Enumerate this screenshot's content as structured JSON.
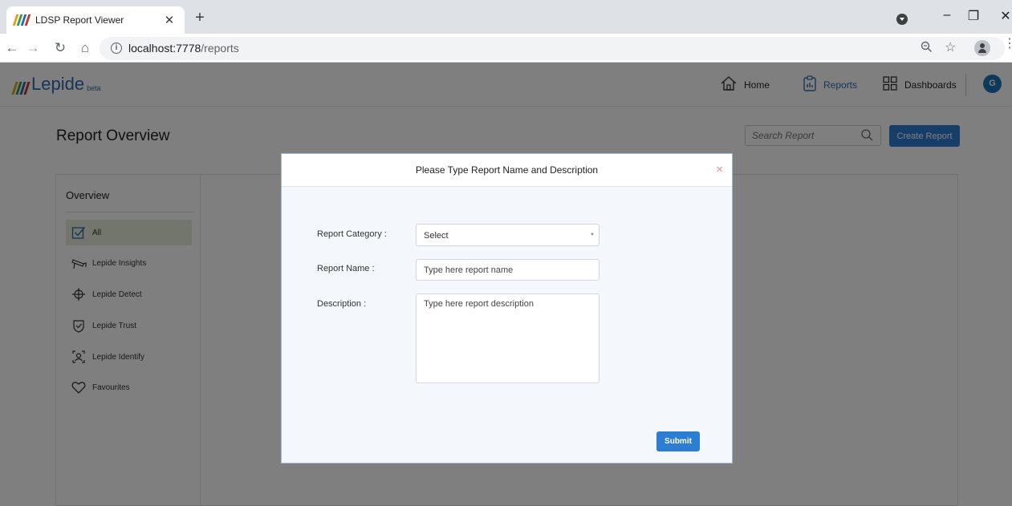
{
  "browser": {
    "tab_title": "LDSP Report Viewer",
    "tab_close": "✕",
    "new_tab": "+",
    "url_host": "localhost:7778",
    "url_path": "/reports"
  },
  "app": {
    "logo_text": "Lepide",
    "logo_badge": "beta",
    "nav": [
      {
        "label": "Home",
        "icon": "home-icon"
      },
      {
        "label": "Reports",
        "icon": "reports-icon",
        "active": true
      },
      {
        "label": "Dashboards",
        "icon": "dashboards-icon"
      }
    ],
    "avatar_initial": "G",
    "page_title": "Report Overview",
    "search_placeholder": "Search Report",
    "create_button": "Create Report",
    "accent_color": "#2d7dd2"
  },
  "sidebar": {
    "heading": "Overview",
    "items": [
      {
        "label": "All",
        "icon": "check-square-icon",
        "active": true
      },
      {
        "label": "Lepide Insights",
        "icon": "cctv-camera-icon"
      },
      {
        "label": "Lepide Detect",
        "icon": "crosshair-icon"
      },
      {
        "label": "Lepide Trust",
        "icon": "shield-check-icon"
      },
      {
        "label": "Lepide Identify",
        "icon": "identify-scan-icon"
      },
      {
        "label": "Favourites",
        "icon": "heart-icon"
      }
    ]
  },
  "modal": {
    "title": "Please Type Report Name and Description",
    "close": "×",
    "category_label": "Report Category :",
    "category_value": "Select",
    "name_label": "Report Name :",
    "name_placeholder": "Type here report name",
    "description_label": "Description :",
    "description_placeholder": "Type here report description",
    "submit": "Submit"
  }
}
